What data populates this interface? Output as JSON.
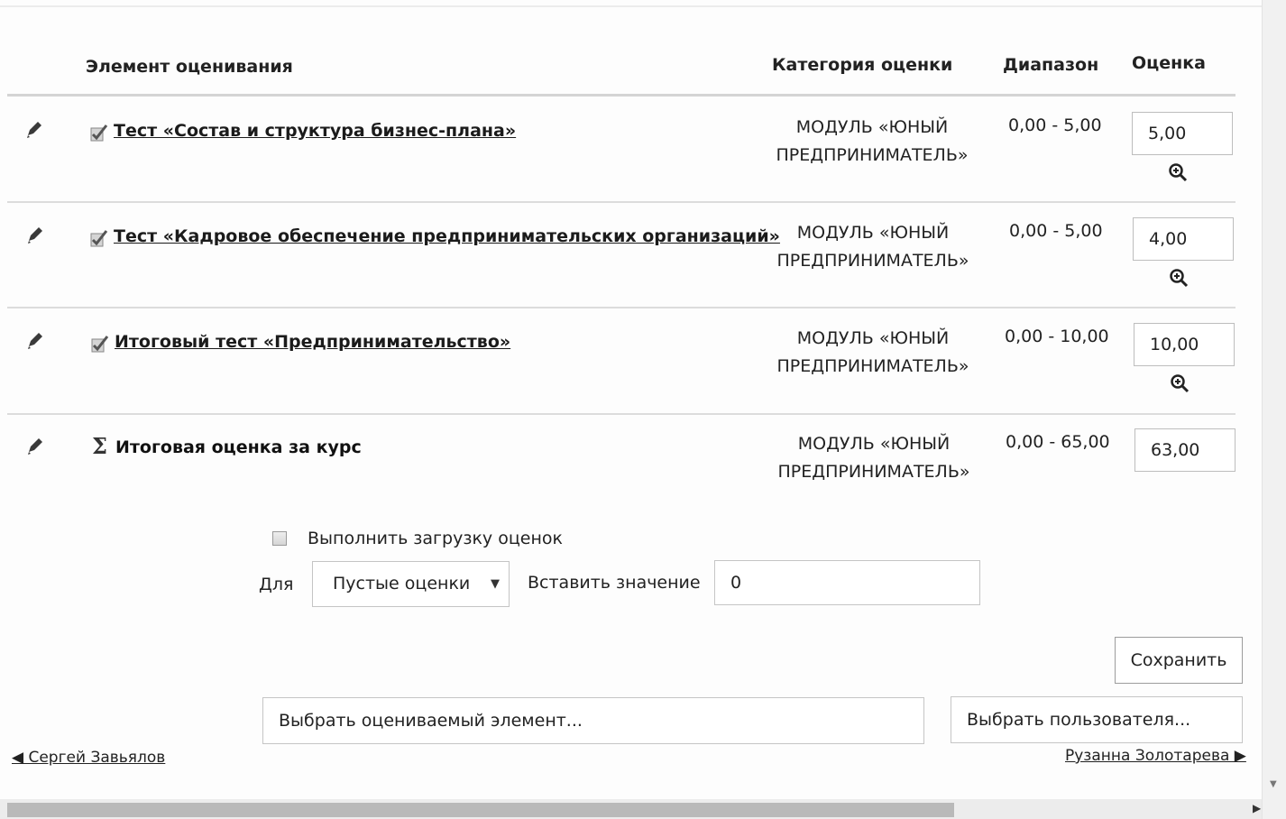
{
  "headers": {
    "element": "Элемент оценивания",
    "category": "Категория оценки",
    "range": "Диапазон",
    "grade": "Оценка"
  },
  "items": [
    {
      "name": "Тест «Состав и структура бизнес-плана»",
      "icon": "quiz-icon",
      "category_line1": "МОДУЛЬ «ЮНЫЙ",
      "category_line2": "ПРЕДПРИНИМАТЕЛЬ»",
      "range": "0,00 - 5,00",
      "grade": "5,00"
    },
    {
      "name": "Тест «Кадровое обеспечение предпринимательских организаций»",
      "icon": "quiz-icon",
      "category_line1": "МОДУЛЬ «ЮНЫЙ",
      "category_line2": "ПРЕДПРИНИМАТЕЛЬ»",
      "range": "0,00 - 5,00",
      "grade": "4,00"
    },
    {
      "name": "Итоговый тест «Предпринимательство»",
      "icon": "quiz-icon",
      "category_line1": "МОДУЛЬ «ЮНЫЙ",
      "category_line2": "ПРЕДПРИНИМАТЕЛЬ»",
      "range": "0,00 - 10,00",
      "grade": "10,00"
    }
  ],
  "total": {
    "symbol": "Σ",
    "name": "Итоговая оценка за курс",
    "category_line1": "МОДУЛЬ «ЮНЫЙ",
    "category_line2": "ПРЕДПРИНИМАТЕЛЬ»",
    "range": "0,00 - 65,00",
    "grade": "63,00"
  },
  "bulk": {
    "checkbox_label": "Выполнить загрузку оценок",
    "checked": false,
    "for_label": "Для",
    "select_value": "Пустые оценки",
    "insert_label": "Вставить значение",
    "insert_value": "0"
  },
  "actions": {
    "save": "Сохранить",
    "select_item": "Выбрать оцениваемый элемент...",
    "select_user": "Выбрать пользователя..."
  },
  "nav": {
    "prev_user": "◀ Сергей Завьялов",
    "next_user": "Рузанна Золотарева ▶"
  }
}
